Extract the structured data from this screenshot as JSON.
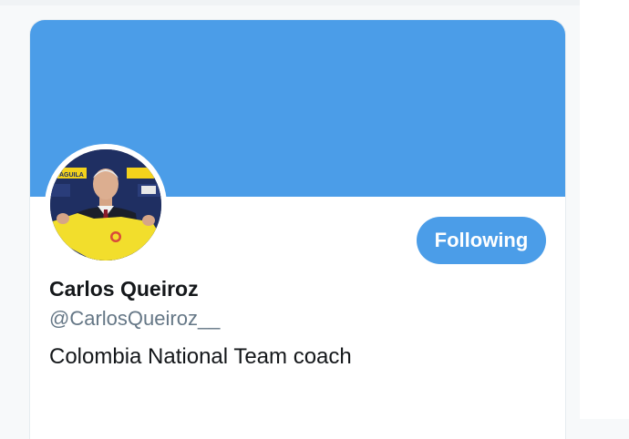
{
  "profile": {
    "display_name": "Carlos Queiroz",
    "handle": "@CarlosQueiroz__",
    "bio": "Colombia National Team coach",
    "follow_button_label": "Following",
    "avatar_sponsor_text": "ÁGUILA"
  },
  "colors": {
    "banner": "#4b9de8",
    "button": "#4b9de8",
    "name_text": "#14171a",
    "handle_text": "#657786"
  }
}
